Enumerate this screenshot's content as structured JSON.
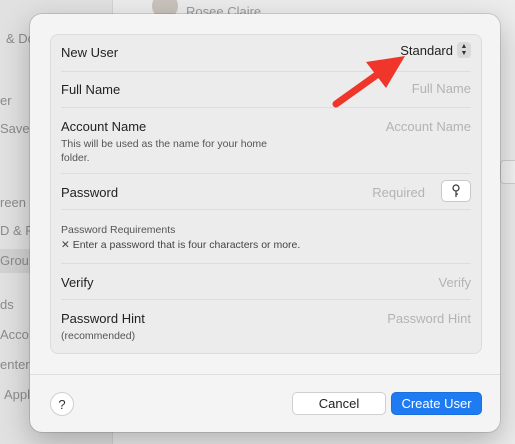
{
  "background": {
    "top_user_name": "Rosee Claire",
    "sidebar_fragments": [
      "& Do",
      "er",
      "Saver",
      "reen",
      "D & Pa",
      "Grou",
      "ds",
      "Acco",
      "enter",
      "Appl"
    ]
  },
  "dialog": {
    "new_user": {
      "label": "New User",
      "value": "Standard"
    },
    "full_name": {
      "label": "Full Name",
      "placeholder": "Full Name"
    },
    "account_name": {
      "label": "Account Name",
      "hint": "This will be used as the name for your home folder.",
      "placeholder": "Account Name"
    },
    "password": {
      "label": "Password",
      "placeholder": "Required"
    },
    "password_requirements": {
      "title": "Password Requirements",
      "item": "✕ Enter a password that is four characters or more."
    },
    "verify": {
      "label": "Verify",
      "placeholder": "Verify"
    },
    "password_hint": {
      "label": "Password Hint",
      "sublabel": "(recommended)",
      "placeholder": "Password Hint"
    },
    "buttons": {
      "help": "?",
      "cancel": "Cancel",
      "create": "Create User"
    }
  },
  "colors": {
    "accent": "#1f7bf2",
    "annotation_arrow": "#f0362a"
  }
}
